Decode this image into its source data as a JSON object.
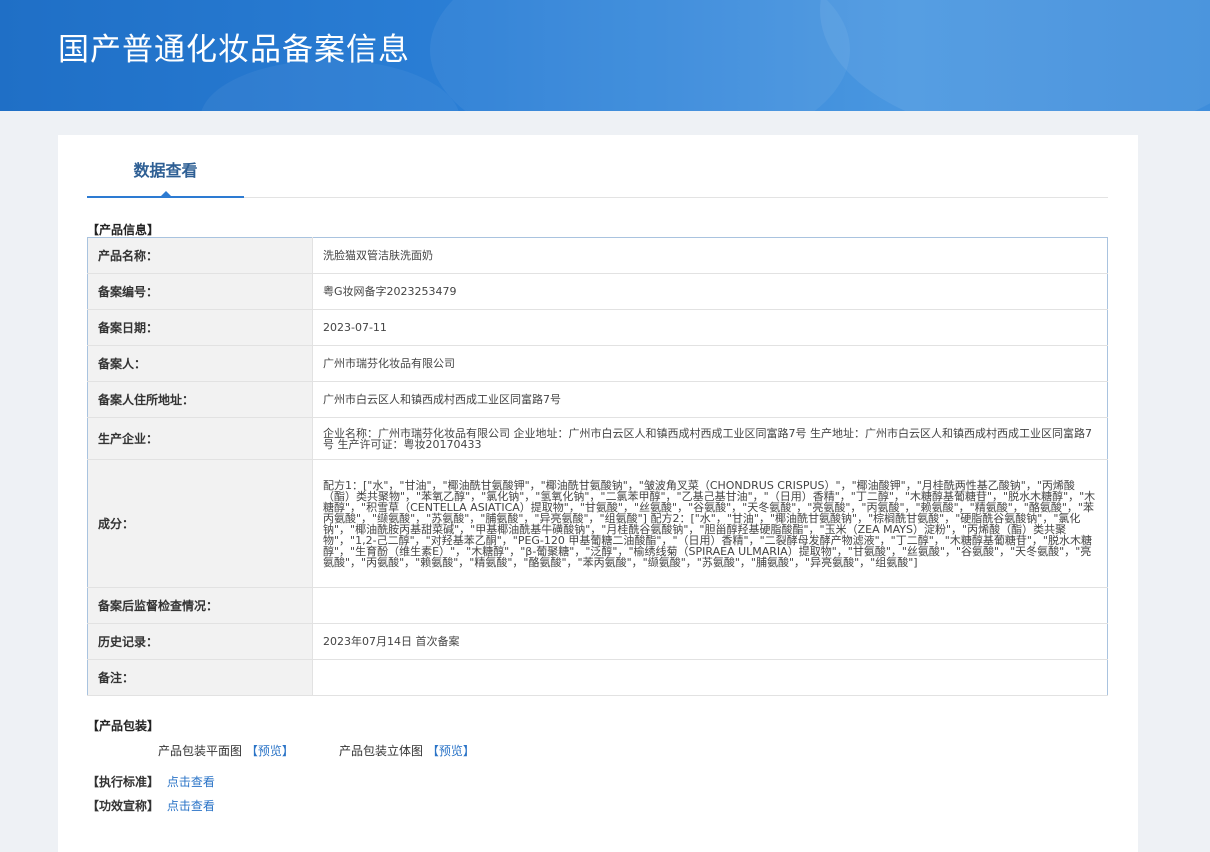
{
  "header": {
    "title": "国产普通化妆品备案信息"
  },
  "tabs": [
    {
      "label": "数据查看"
    }
  ],
  "product_info": {
    "section_label": "【产品信息】",
    "rows": [
      {
        "label": "产品名称：",
        "value": "洗脸猫双管洁肤洗面奶"
      },
      {
        "label": "备案编号：",
        "value": "粤G妆网备字2023253479"
      },
      {
        "label": "备案日期：",
        "value": "2023-07-11"
      },
      {
        "label": "备案人：",
        "value": "广州市瑞芬化妆品有限公司"
      },
      {
        "label": "备案人住所地址：",
        "value": "广州市白云区人和镇西成村西成工业区同富路7号"
      },
      {
        "label": "生产企业：",
        "value": "企业名称：广州市瑞芬化妆品有限公司 企业地址：广州市白云区人和镇西成村西成工业区同富路7号 生产地址：广州市白云区人和镇西成村西成工业区同富路7号 生产许可证：粤妆20170433"
      },
      {
        "label": "成分：",
        "value": "配方1：[\"水\"，\"甘油\"，\"椰油酰甘氨酸钾\"，\"椰油酰甘氨酸钠\"，\"皱波角叉菜（CHONDRUS CRISPUS）\"，\"椰油酸钾\"，\"月桂酰两性基乙酸钠\"，\"丙烯酸（酯）类共聚物\"，\"苯氧乙醇\"，\"氯化钠\"，\"氢氧化钠\"，\"二氯苯甲醇\"，\"乙基己基甘油\"，\"（日用）香精\"，\"丁二醇\"，\"木糖醇基葡糖苷\"，\"脱水木糖醇\"，\"木糖醇\"，\"积雪草（CENTELLA ASIATICA）提取物\"，\"甘氨酸\"，\"丝氨酸\"，\"谷氨酸\"，\"天冬氨酸\"，\"亮氨酸\"，\"丙氨酸\"，\"赖氨酸\"，\"精氨酸\"，\"酪氨酸\"，\"苯丙氨酸\"，\"缬氨酸\"，\"苏氨酸\"，\"脯氨酸\"，\"异亮氨酸\"，\"组氨酸\"] 配方2：[\"水\"，\"甘油\"，\"椰油酰甘氨酸钠\"，\"棕榈酰甘氨酸\"，\"硬脂酰谷氨酸钠\"，\"氯化钠\"，\"椰油酰胺丙基甜菜碱\"，\"甲基椰油酰基牛磺酸钠\"，\"月桂酰谷氨酸钠\"，\"胆甾醇羟基硬脂酸酯\"，\"玉米（ZEA MAYS）淀粉\"，\"丙烯酸（酯）类共聚物\"，\"1,2-己二醇\"，\"对羟基苯乙酮\"，\"PEG-120 甲基葡糖二油酸酯\"，\"（日用）香精\"，\"二裂酵母发酵产物滤液\"，\"丁二醇\"，\"木糖醇基葡糖苷\"，\"脱水木糖醇\"，\"生育酚（维生素E）\"，\"木糖醇\"，\"β-葡聚糖\"，\"泛醇\"，\"榆绣线菊（SPIRAEA ULMARIA）提取物\"，\"甘氨酸\"，\"丝氨酸\"，\"谷氨酸\"，\"天冬氨酸\"，\"亮氨酸\"，\"丙氨酸\"，\"赖氨酸\"，\"精氨酸\"，\"酪氨酸\"，\"苯丙氨酸\"，\"缬氨酸\"，\"苏氨酸\"，\"脯氨酸\"，\"异亮氨酸\"，\"组氨酸\"]"
      },
      {
        "label": "备案后监督检查情况：",
        "value": ""
      },
      {
        "label": "历史记录：",
        "value": "2023年07月14日  首次备案 "
      },
      {
        "label": "备注：",
        "value": ""
      }
    ]
  },
  "packaging": {
    "section_label": "【产品包装】",
    "flat_label": "产品包装平面图",
    "flat_link": "【预览】",
    "stereo_label": "产品包装立体图",
    "stereo_link": "【预览】"
  },
  "standard": {
    "label": "【执行标准】",
    "link": "点击查看"
  },
  "efficacy": {
    "label": "【功效宣称】",
    "link": "点击查看"
  },
  "colors": {
    "banner": "#2b7fd6",
    "accent": "#2d7bd2",
    "link": "#2b74c7"
  }
}
